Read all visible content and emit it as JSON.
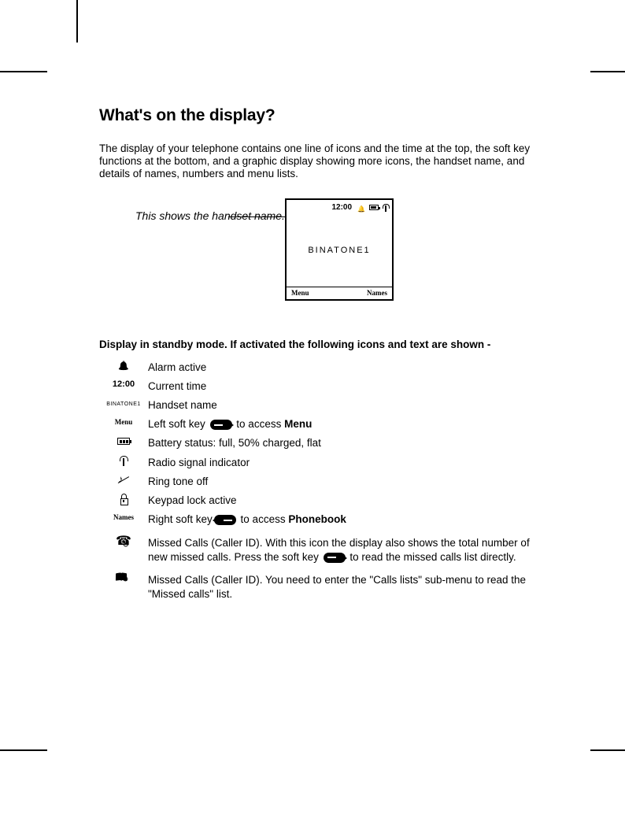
{
  "heading": "What's on the display?",
  "intro": "The display of your telephone contains one line of icons and the time at the top, the soft key functions at the bottom, and a graphic display showing more icons, the handset name, and details of names, numbers and menu lists.",
  "callout": "This shows the handset name.",
  "screen": {
    "time": "12:00",
    "handset_name": "BINATONE1",
    "left_softkey": "Menu",
    "right_softkey": "Names"
  },
  "subheading": "Display in standby mode. If activated the following icons and text are shown -",
  "rows": {
    "alarm": {
      "label": "",
      "desc": "Alarm active"
    },
    "time": {
      "label": "12:00",
      "desc": "Current time"
    },
    "handset": {
      "label": "BINATONE1",
      "desc": "Handset name"
    },
    "leftsoft": {
      "label": "Menu",
      "desc_pre": "Left soft key ",
      "desc_post": " to access ",
      "bold": "Menu"
    },
    "battery": {
      "desc": "Battery status: full, 50% charged, flat"
    },
    "radio": {
      "desc": "Radio signal indicator"
    },
    "ringoff": {
      "desc": "Ring tone off"
    },
    "lock": {
      "desc": "Keypad lock active"
    },
    "rightsoft": {
      "label": "Names",
      "desc_pre": "Right soft key",
      "desc_post": " to access ",
      "bold": "Phonebook"
    },
    "missed1": {
      "desc_pre": "Missed Calls (Caller ID). With this icon the display also shows the total number of new missed calls. Press the soft key ",
      "desc_post": " to read the missed calls list directly."
    },
    "missed2": {
      "desc": "Missed Calls (Caller ID). You need to enter the \"Calls lists\" sub-menu to read the \"Missed calls\" list."
    }
  }
}
